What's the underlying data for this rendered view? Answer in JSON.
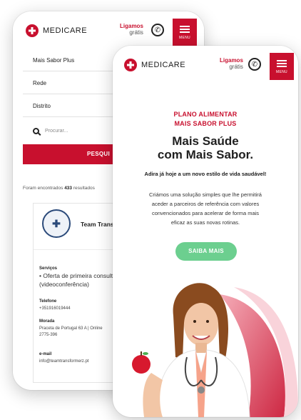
{
  "brand": {
    "name": "MEDICARE",
    "accent": "#c8102e",
    "cta_color": "#6ccf8f"
  },
  "header": {
    "call_line1": "Ligamos",
    "call_line2": "grátis",
    "menu_label": "MENU",
    "phone_icon": "phone-icon",
    "menu_icon": "hamburger-icon"
  },
  "search_form": {
    "plan_value": "Mais Sabor Plus",
    "network_value": "Rede",
    "district_value": "Distrito",
    "search_placeholder": "Procurar...",
    "search_button": "PESQUI"
  },
  "results": {
    "prefix": "Foram encontrados",
    "count": "433",
    "suffix": "resultados"
  },
  "provider_card": {
    "name": "Team Transf",
    "services_label": "Serviços",
    "services_line1": "• Oferta de primeira consult",
    "services_line2": "(videoconferência)",
    "phone_label": "Telefone",
    "phone_value": "+351916019444",
    "address_label": "Morada",
    "address_line1": "Praceta de Portugal 63 A | Online",
    "address_line2": "2775-396",
    "email_label": "e-mail",
    "email_value": "info@teamtransformerz.pt"
  },
  "hero": {
    "eyebrow_line1": "PLANO ALIMENTAR",
    "eyebrow_line2": "MAIS SABOR PLUS",
    "title_line1": "Mais Saúde",
    "title_line2": "com Mais Sabor.",
    "lead": "Adira já hoje a um novo estilo de vida saudável!",
    "body_line1": "Criámos uma solução simples que lhe permitirá",
    "body_line2": "aceder a parceiros de referência com valores",
    "body_line3": "convencionados para acelerar de forma mais",
    "body_line4": "eficaz as suas novas rotinas.",
    "cta_label": "SAIBA MAIS"
  }
}
